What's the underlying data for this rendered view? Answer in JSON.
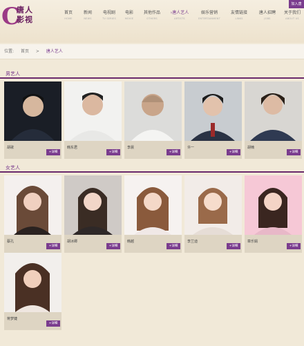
{
  "logo": {
    "mark": "C",
    "text": "唐人影视"
  },
  "header": {
    "join_label": "加入唐",
    "nav": [
      {
        "label": "首页",
        "sub": "HOME"
      },
      {
        "label": "新闻",
        "sub": "NEWS"
      },
      {
        "label": "电视剧",
        "sub": "TV SERIES"
      },
      {
        "label": "电影",
        "sub": "MOVIE"
      },
      {
        "label": "其他作品",
        "sub": "OTHERS"
      },
      {
        "label": "唐人艺人",
        "sub": "ARTISTS",
        "active": true
      },
      {
        "label": "娱乐营销",
        "sub": "ENTERTAINMENT"
      },
      {
        "label": "友情链接",
        "sub": "LINKS"
      },
      {
        "label": "唐人招聘",
        "sub": "JOBS"
      },
      {
        "label": "关于我们",
        "sub": "ABOUT US"
      }
    ]
  },
  "breadcrumb": {
    "prefix": "位置:",
    "home": "首页",
    "sep": ">",
    "current": "唐人艺人"
  },
  "male": {
    "title": "男艺人",
    "artists": [
      {
        "name": "胡歌",
        "detail": "+详细"
      },
      {
        "name": "韩东君",
        "detail": "+详细"
      },
      {
        "name": "李晨",
        "detail": "+详细"
      },
      {
        "name": "许一",
        "detail": "+详细"
      },
      {
        "name": "胡楠",
        "detail": "+详细"
      }
    ]
  },
  "female": {
    "title": "女艺人",
    "artists": [
      {
        "name": "蔡孔",
        "detail": "+详细"
      },
      {
        "name": "胡冰卿",
        "detail": "+详细"
      },
      {
        "name": "韩越",
        "detail": "+详细"
      },
      {
        "name": "李兰迪",
        "detail": "+详细"
      },
      {
        "name": "章乐娟",
        "detail": "+详细"
      },
      {
        "name": "蒋梦婕",
        "detail": "+详细"
      }
    ]
  }
}
